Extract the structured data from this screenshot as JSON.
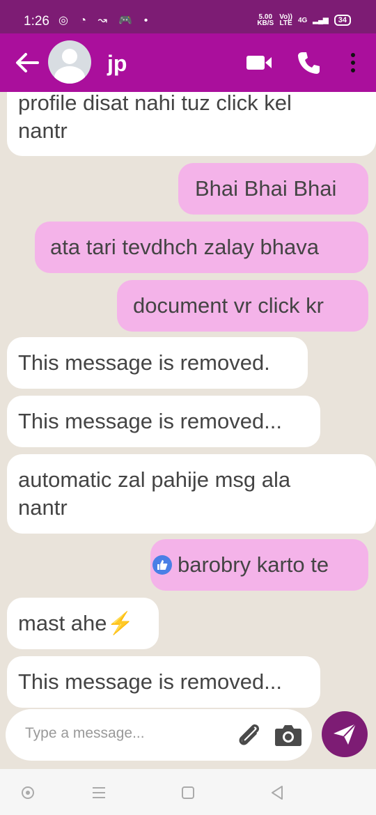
{
  "status_bar": {
    "time": "1:26",
    "icons": "◎ ◔ ↝ 🎮 •",
    "speed_value": "5.00",
    "speed_unit": "KB/S",
    "network_top": "Vo))",
    "network_bottom": "LTE",
    "signal": "4G",
    "battery": "34"
  },
  "header": {
    "contact_name": "jp",
    "icons": [
      "back-arrow-icon",
      "avatar",
      "video-call-icon",
      "phone-call-icon",
      "more-options-icon"
    ]
  },
  "messages": [
    {
      "direction": "incoming",
      "lines": [
        "profile disat nahi tuz click kel",
        "nantr"
      ]
    },
    {
      "direction": "outgoing",
      "lines": [
        "Bhai Bhai Bhai"
      ]
    },
    {
      "direction": "outgoing",
      "lines": [
        "ata tari tevdhch zalay bhava"
      ]
    },
    {
      "direction": "outgoing",
      "lines": [
        "document vr click kr"
      ]
    },
    {
      "direction": "incoming",
      "lines": [
        "This message is removed."
      ]
    },
    {
      "direction": "incoming",
      "lines": [
        "This message is removed..."
      ]
    },
    {
      "direction": "incoming",
      "lines": [
        "automatic zal pahije msg ala",
        "nantr"
      ]
    },
    {
      "direction": "outgoing",
      "lines": [
        "barobry karto te"
      ],
      "icon": "like-icon"
    },
    {
      "direction": "incoming",
      "lines": [
        "mast ahe"
      ],
      "emoji": "⚡"
    },
    {
      "direction": "incoming",
      "lines": [
        "This message is removed..."
      ]
    }
  ],
  "composer": {
    "placeholder": "Type a message...",
    "value": ""
  },
  "colors": {
    "status_bar": "#7d1c74",
    "app_bar": "#aa0f9c",
    "outgoing_bubble": "#f4b3e9",
    "incoming_bubble": "#ffffff",
    "send_button": "#7d1c74",
    "chat_background": "#e9e3da"
  }
}
